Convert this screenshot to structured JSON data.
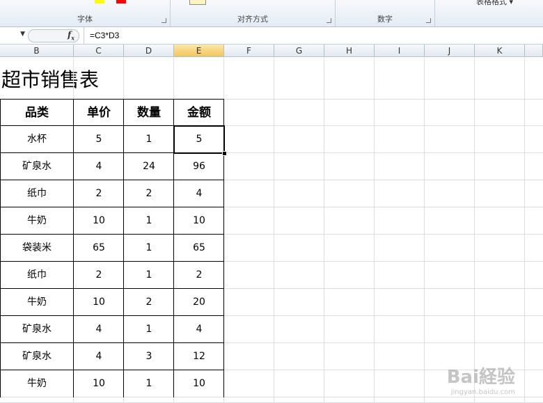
{
  "ribbon": {
    "groups": [
      {
        "label": "字体"
      },
      {
        "label": "对齐方式"
      },
      {
        "label": "数字"
      }
    ],
    "styles_label": "表格格式 ▾"
  },
  "formula_bar": {
    "fx": "fx",
    "formula": "=C3*D3"
  },
  "columns": [
    "B",
    "C",
    "D",
    "E",
    "F",
    "G",
    "H",
    "I",
    "J",
    "K"
  ],
  "selected_column": "E",
  "sheet": {
    "title": "超市销售表",
    "headers": [
      "品类",
      "单价",
      "数量",
      "金额"
    ],
    "rows": [
      [
        "水杯",
        "5",
        "1",
        "5"
      ],
      [
        "矿泉水",
        "4",
        "24",
        "96"
      ],
      [
        "纸巾",
        "2",
        "2",
        "4"
      ],
      [
        "牛奶",
        "10",
        "1",
        "10"
      ],
      [
        "袋装米",
        "65",
        "1",
        "65"
      ],
      [
        "纸巾",
        "2",
        "1",
        "2"
      ],
      [
        "牛奶",
        "10",
        "2",
        "20"
      ],
      [
        "矿泉水",
        "4",
        "1",
        "4"
      ],
      [
        "矿泉水",
        "4",
        "3",
        "12"
      ],
      [
        "牛奶",
        "10",
        "1",
        "10"
      ]
    ]
  },
  "colors": {
    "selected_header": "#f4c65a",
    "swatch_yellow": "#ffff00",
    "swatch_red": "#ff0000"
  }
}
